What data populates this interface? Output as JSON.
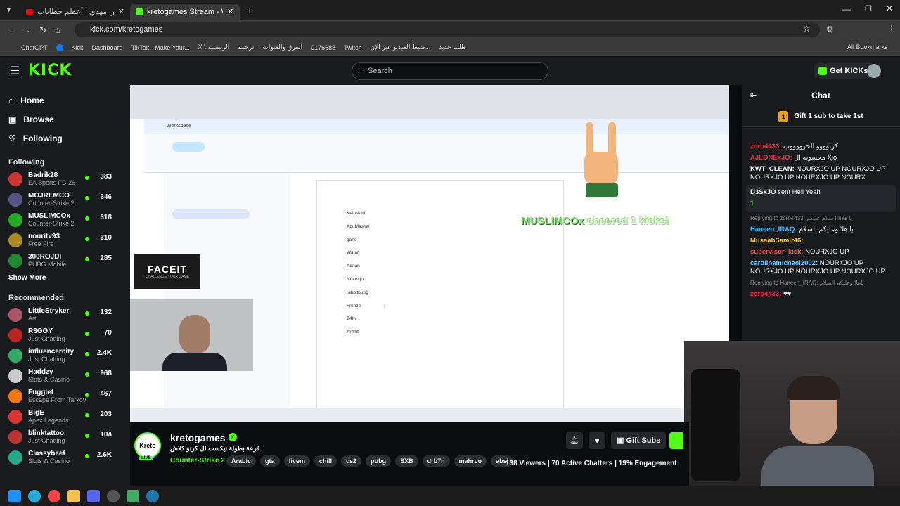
{
  "browser": {
    "tabs": [
      {
        "label": "الفنان فارس مهدي | أعظم خطابات",
        "active": false
      },
      {
        "label": "kretogames Stream - Watch",
        "active": true
      }
    ],
    "url": "kick.com/kretogames",
    "bookmarks": [
      "ChatGPT",
      "Facebook",
      "Kick",
      "Dashboard",
      "TikTok - Make Your...",
      "X \\ الرئيسية",
      "ترجمة",
      "الفرق والقنوات",
      "0176683",
      "Twitch",
      "ضبط الفيديو عبر الإن...",
      "طلب جديد",
      "All Bookmarks"
    ]
  },
  "kick": {
    "logo": "KICK",
    "search_placeholder": "Search",
    "get_kicks": "Get KICKs"
  },
  "sidebar": {
    "nav": [
      {
        "label": "Home",
        "icon": "home-icon"
      },
      {
        "label": "Browse",
        "icon": "browse-icon"
      },
      {
        "label": "Following",
        "icon": "heart-icon"
      }
    ],
    "following_title": "Following",
    "following": [
      {
        "name": "Badrik28",
        "game": "EA Sports FC 26",
        "viewers": "383",
        "color": "#c33"
      },
      {
        "name": "MOJREMCO",
        "game": "Counter-Strike 2",
        "viewers": "346",
        "color": "#558"
      },
      {
        "name": "MUSLIMCOx",
        "game": "Counter-Strike 2",
        "viewers": "318",
        "color": "#2a2"
      },
      {
        "name": "nouritv93",
        "game": "Free Fire",
        "viewers": "310",
        "color": "#a82"
      },
      {
        "name": "300ROJDI",
        "game": "PUBG Mobile",
        "viewers": "285",
        "color": "#283"
      }
    ],
    "show_more": "Show More",
    "recommended_title": "Recommended",
    "recommended": [
      {
        "name": "LittleStryker",
        "game": "Art",
        "viewers": "132",
        "color": "#a56"
      },
      {
        "name": "R3GGY",
        "game": "Just Chatting",
        "viewers": "70",
        "color": "#b22"
      },
      {
        "name": "influencercity",
        "game": "Just Chatting",
        "viewers": "2.4K",
        "color": "#3a6"
      },
      {
        "name": "Haddzy",
        "game": "Slots & Casino",
        "viewers": "968",
        "color": "#ccc"
      },
      {
        "name": "Fugglet",
        "game": "Escape From Tarkov",
        "viewers": "467",
        "color": "#e71"
      },
      {
        "name": "BigE",
        "game": "Apex Legends",
        "viewers": "203",
        "color": "#d33"
      },
      {
        "name": "blinktattoo",
        "game": "Just Chatting",
        "viewers": "104",
        "color": "#b33"
      },
      {
        "name": "Classybeef",
        "game": "Slots & Casino",
        "viewers": "2.6K",
        "color": "#2a8"
      }
    ]
  },
  "stream": {
    "doc_names": [
      "KeLvAxd",
      "AbuMashal",
      "gano",
      "Watan",
      "Adnan",
      "NOurxjo",
      "rabbitpubg",
      "Freeze",
      "Z4IN",
      "Ar4nit"
    ],
    "cheer_name": "MUSLIMCOx",
    "cheer_text": "cheered 1 kicks!",
    "facet_logo": "FACEIT",
    "facet_sub": "CHALLENGE YOUR GAME",
    "workspace": "Workspace"
  },
  "channel": {
    "name": "kretogames",
    "title": "قرعة بطولة تيكست لل كرتو كلاش",
    "category": "Counter-Strike 2",
    "tags": [
      "Arabic",
      "gta",
      "fivem",
      "chill",
      "cs2",
      "pubg",
      "SXB",
      "drb7h",
      "mahrco",
      "absi"
    ],
    "viewers": "138 Viewers",
    "chatters": "70 Active Chatters",
    "engagement": "19% Engagement",
    "gift_subs": "Gift Subs",
    "avatar_text": "Kreto",
    "live": "LIVE"
  },
  "chat": {
    "title": "Chat",
    "gift_banner": "Gift 1 sub to take 1st",
    "gift_count": "1",
    "messages": [
      {
        "user": "zoro4433:",
        "text": "كرتوووو الحرووووب",
        "color": "#e34"
      },
      {
        "user": "AJLONExJO:",
        "text": "محسوبه ال Xjo",
        "color": "#e34"
      },
      {
        "user": "KWT_CLEAN:",
        "text": "NOURXJO UP NOURXJO UP NOURXJO UP NOURXJO UP NOURX",
        "color": "#fff"
      },
      {
        "user": "D3SxJO",
        "text": "sent Hell Yeah",
        "color": "#fff",
        "special": true
      },
      {
        "user": "",
        "text": "Replying to zoro4433: يا هلااااا سلام عليكم",
        "color": "#888",
        "reply": true
      },
      {
        "user": "Haneen_IRAQ:",
        "text": "يا هلا وعليكم السلام",
        "color": "#3bf"
      },
      {
        "user": "MusaabSamir46:",
        "text": "",
        "color": "#fc3"
      },
      {
        "user": "supervisor_kick:",
        "text": "NOURXJO UP",
        "color": "#e55"
      },
      {
        "user": "carolinamichael2002:",
        "text": "NOURXJO UP NOURXJO UP NOURXJO UP NOURXJO UP",
        "color": "#6cf"
      },
      {
        "user": "",
        "text": "Replying to Haneen_IRAQ: ياهلا وعليكم السلام",
        "color": "#888",
        "reply": true
      },
      {
        "user": "zoro4433:",
        "text": "♥♥",
        "color": "#e34"
      }
    ],
    "gift_points": "1"
  }
}
